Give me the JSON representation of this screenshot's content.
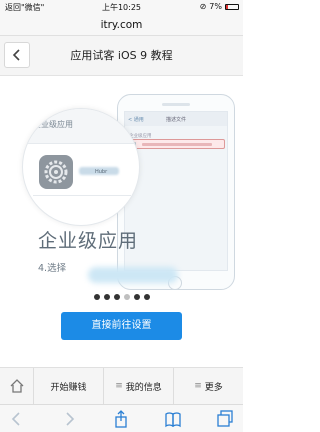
{
  "status_bar": {
    "left": "返回\"微信\"",
    "time": "上午10:25",
    "battery": "7%"
  },
  "url_bar": {
    "host": "itry.com"
  },
  "header": {
    "title": "应用试客 iOS 9 教程"
  },
  "illustration": {
    "circle_title": "企业级应用",
    "circle_caption": "Hubr",
    "phone_back": "< 通用",
    "phone_title": "描述文件",
    "phone_section": "企业级应用",
    "step_label": "4.选择",
    "big_label": "企业级应用"
  },
  "pagination": {
    "total": 6,
    "active_index": 3
  },
  "action_button": {
    "label": "直接前往设置"
  },
  "site_nav": {
    "items": [
      {
        "label": "开始赚钱"
      },
      {
        "label": "我的信息"
      },
      {
        "label": "更多"
      }
    ]
  },
  "colors": {
    "accent": "#1c8be6",
    "battery_low": "#dd3333"
  }
}
